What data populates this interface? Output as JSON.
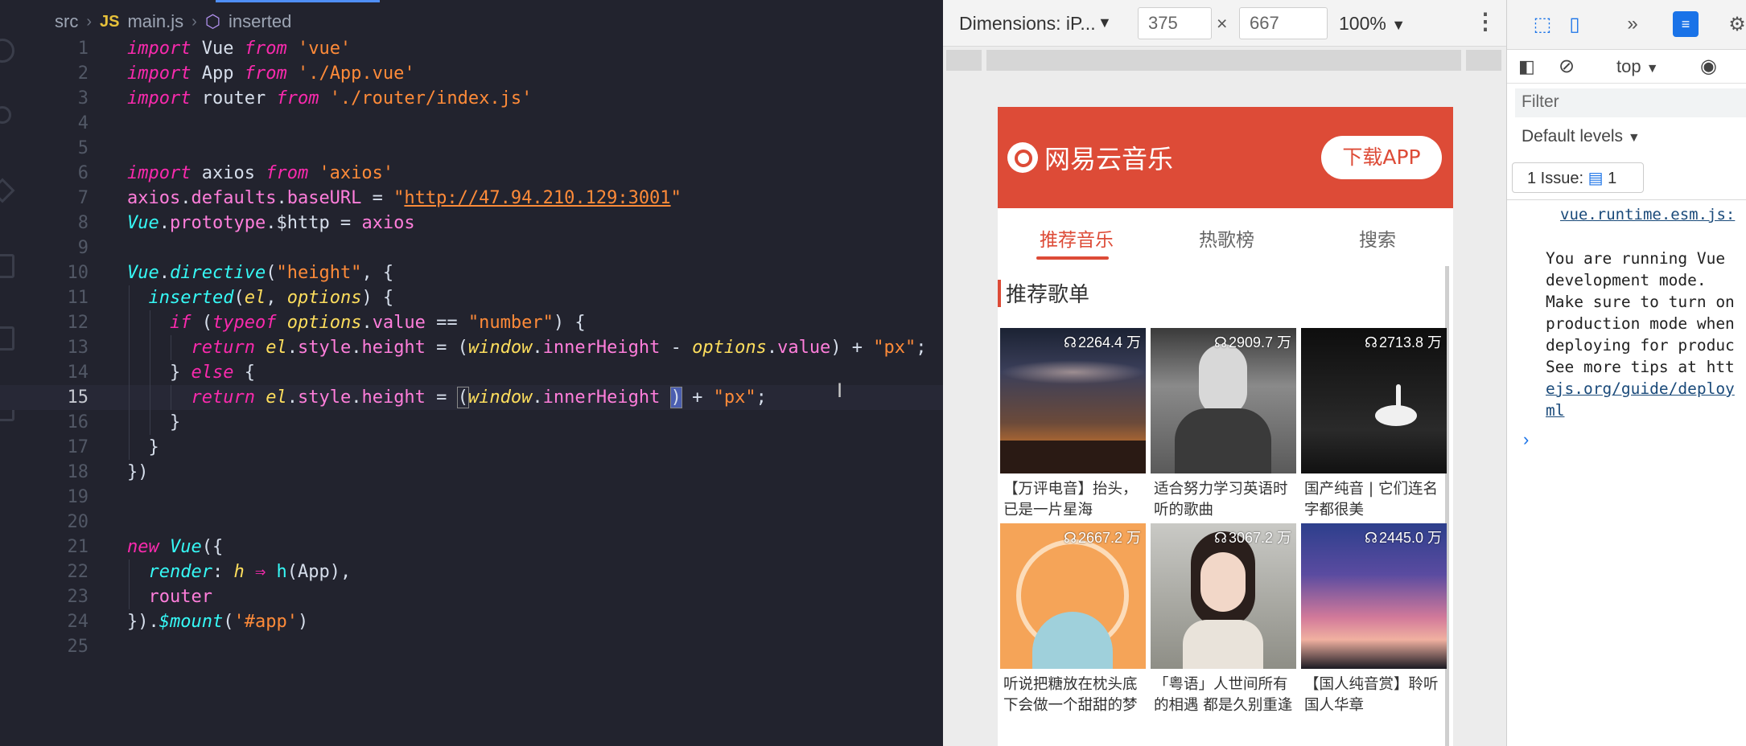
{
  "editor": {
    "breadcrumb": {
      "folder": "src",
      "file_badge": "JS",
      "file": "main.js",
      "symbol": "inserted"
    }
  },
  "device_toolbar": {
    "dimensions_label": "Dimensions: iP...",
    "width": "375",
    "height": "667",
    "times": "×",
    "zoom": "100%"
  },
  "app": {
    "brand": "网易云音乐",
    "download_button": "下载APP",
    "tabs": [
      "推荐音乐",
      "热歌榜",
      "搜索"
    ],
    "active_tab": 0,
    "section_title": "推荐歌单",
    "playlists": [
      {
        "count": "2264.4 万",
        "title": "【万评电音】抬头，已是一片星海"
      },
      {
        "count": "2909.7 万",
        "title": "适合努力学习英语时听的歌曲"
      },
      {
        "count": "2713.8 万",
        "title": "国产纯音 | 它们连名字都很美"
      },
      {
        "count": "2667.2 万",
        "title": "听说把糖放在枕头底下会做一个甜甜的梦"
      },
      {
        "count": "3067.2 万",
        "title": "「粤语」人世间所有的相遇 都是久别重逢"
      },
      {
        "count": "2445.0 万",
        "title": "【国人纯音赏】聆听国人华章"
      }
    ]
  },
  "console": {
    "context": "top",
    "filter_placeholder": "Filter",
    "levels": "Default levels",
    "issues_label": "1 Issue:",
    "issues_count": "1",
    "source_link": "vue.runtime.esm.js:",
    "message_lines": [
      "You are running Vue",
      "development mode.",
      "Make sure to turn on",
      "production mode when",
      "deploying for produc",
      "See more tips at htt",
      "ejs.org/guide/deploy",
      "ml"
    ]
  }
}
